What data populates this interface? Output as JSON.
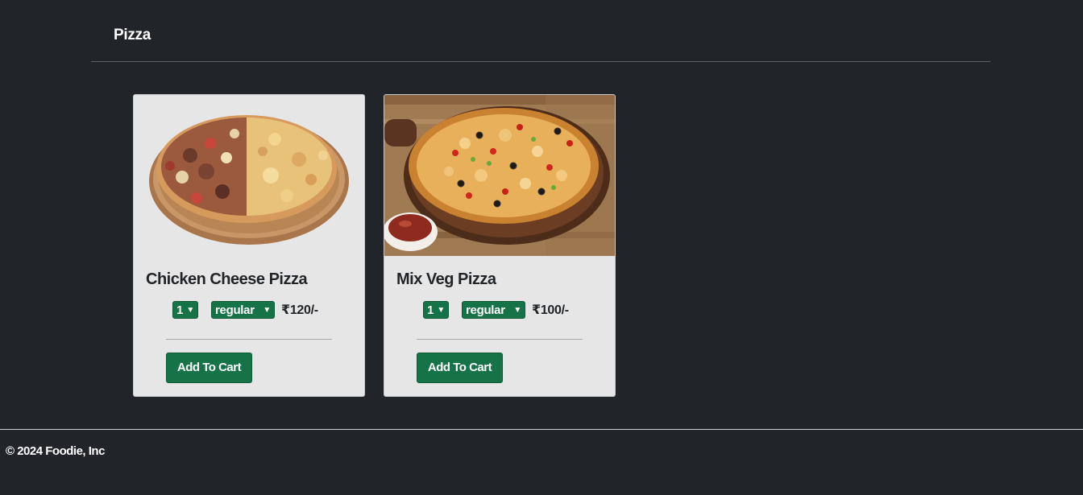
{
  "category": {
    "title": "Pizza"
  },
  "products": [
    {
      "name": "Chicken Cheese Pizza",
      "quantity": "1",
      "size": "regular",
      "price": "₹120/-",
      "button_label": "Add To Cart",
      "image_icon": "chicken-cheese-pizza-image"
    },
    {
      "name": "Mix Veg Pizza",
      "quantity": "1",
      "size": "regular",
      "price": "₹100/-",
      "button_label": "Add To Cart",
      "image_icon": "mix-veg-pizza-image"
    }
  ],
  "footer": {
    "copyright": "© 2024 Foodie, Inc"
  },
  "colors": {
    "background": "#212529",
    "card": "#e6e6e6",
    "accent_green": "#157347"
  }
}
